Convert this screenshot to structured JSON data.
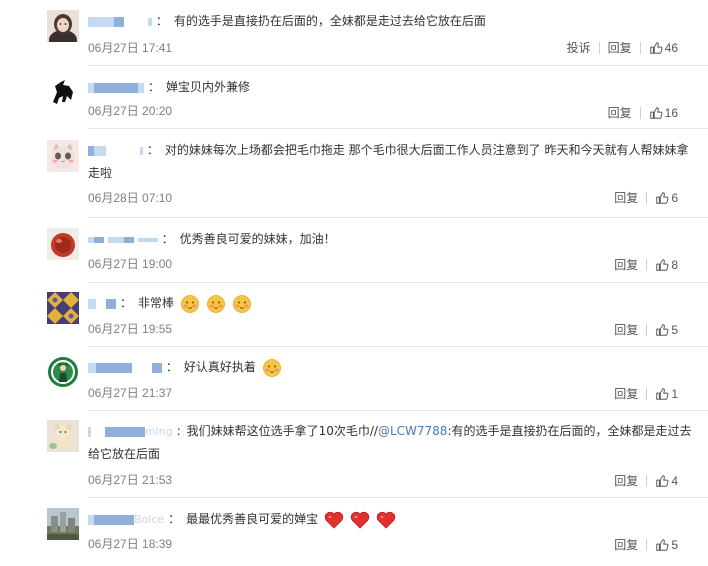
{
  "comments": [
    {
      "text": "有的选手是直接扔在后面的，全妹都是走过去给它放在后面",
      "time": "06月27日 17:41",
      "report_label": "投诉",
      "reply_label": "回复",
      "likes": "46",
      "avatar": "girl-photo-avatar"
    },
    {
      "text": "婵宝贝内外兼修",
      "time": "06月27日 20:20",
      "reply_label": "回复",
      "likes": "16",
      "avatar": "horse-logo-avatar"
    },
    {
      "text": "对的妹妹每次上场都会把毛巾拖走 那个毛巾很大后面工作人员注意到了 昨天和今天就有人帮妹妹拿走啦",
      "time": "06月28日 07:10",
      "reply_label": "回复",
      "likes": "6",
      "avatar": "cat-face-avatar"
    },
    {
      "text": "优秀善良可爱的妹妹，加油！",
      "time": "06月27日 19:00",
      "reply_label": "回复",
      "likes": "8",
      "avatar": "red-drink-avatar"
    },
    {
      "text": "非常棒",
      "time": "06月27日 19:55",
      "reply_label": "回复",
      "likes": "5",
      "avatar": "pattern-avatar"
    },
    {
      "text": "好认真好执着",
      "time": "06月27日 21:37",
      "reply_label": "回复",
      "likes": "1",
      "avatar": "celtics-logo-avatar"
    },
    {
      "text_before": "我们妹妹帮这位选手拿了10次毛巾//",
      "mention": "@LCW7788",
      "text_after": ":有的选手是直接扔在后面的，全妹都是走过去给它放在后面",
      "username_fragment": "ming",
      "time": "06月27日 21:53",
      "reply_label": "回复",
      "likes": "4",
      "avatar": "plush-toy-avatar"
    },
    {
      "text": "最最优秀善良可爱的婵宝",
      "username_fragment": "Bolce",
      "time": "06月27日 18:39",
      "reply_label": "回复",
      "likes": "5",
      "avatar": "city-photo-avatar"
    }
  ],
  "colors": {
    "link": "#4a78b3",
    "time": "#808080",
    "separator": "#e6e6e6",
    "heart": "#e0312e"
  }
}
